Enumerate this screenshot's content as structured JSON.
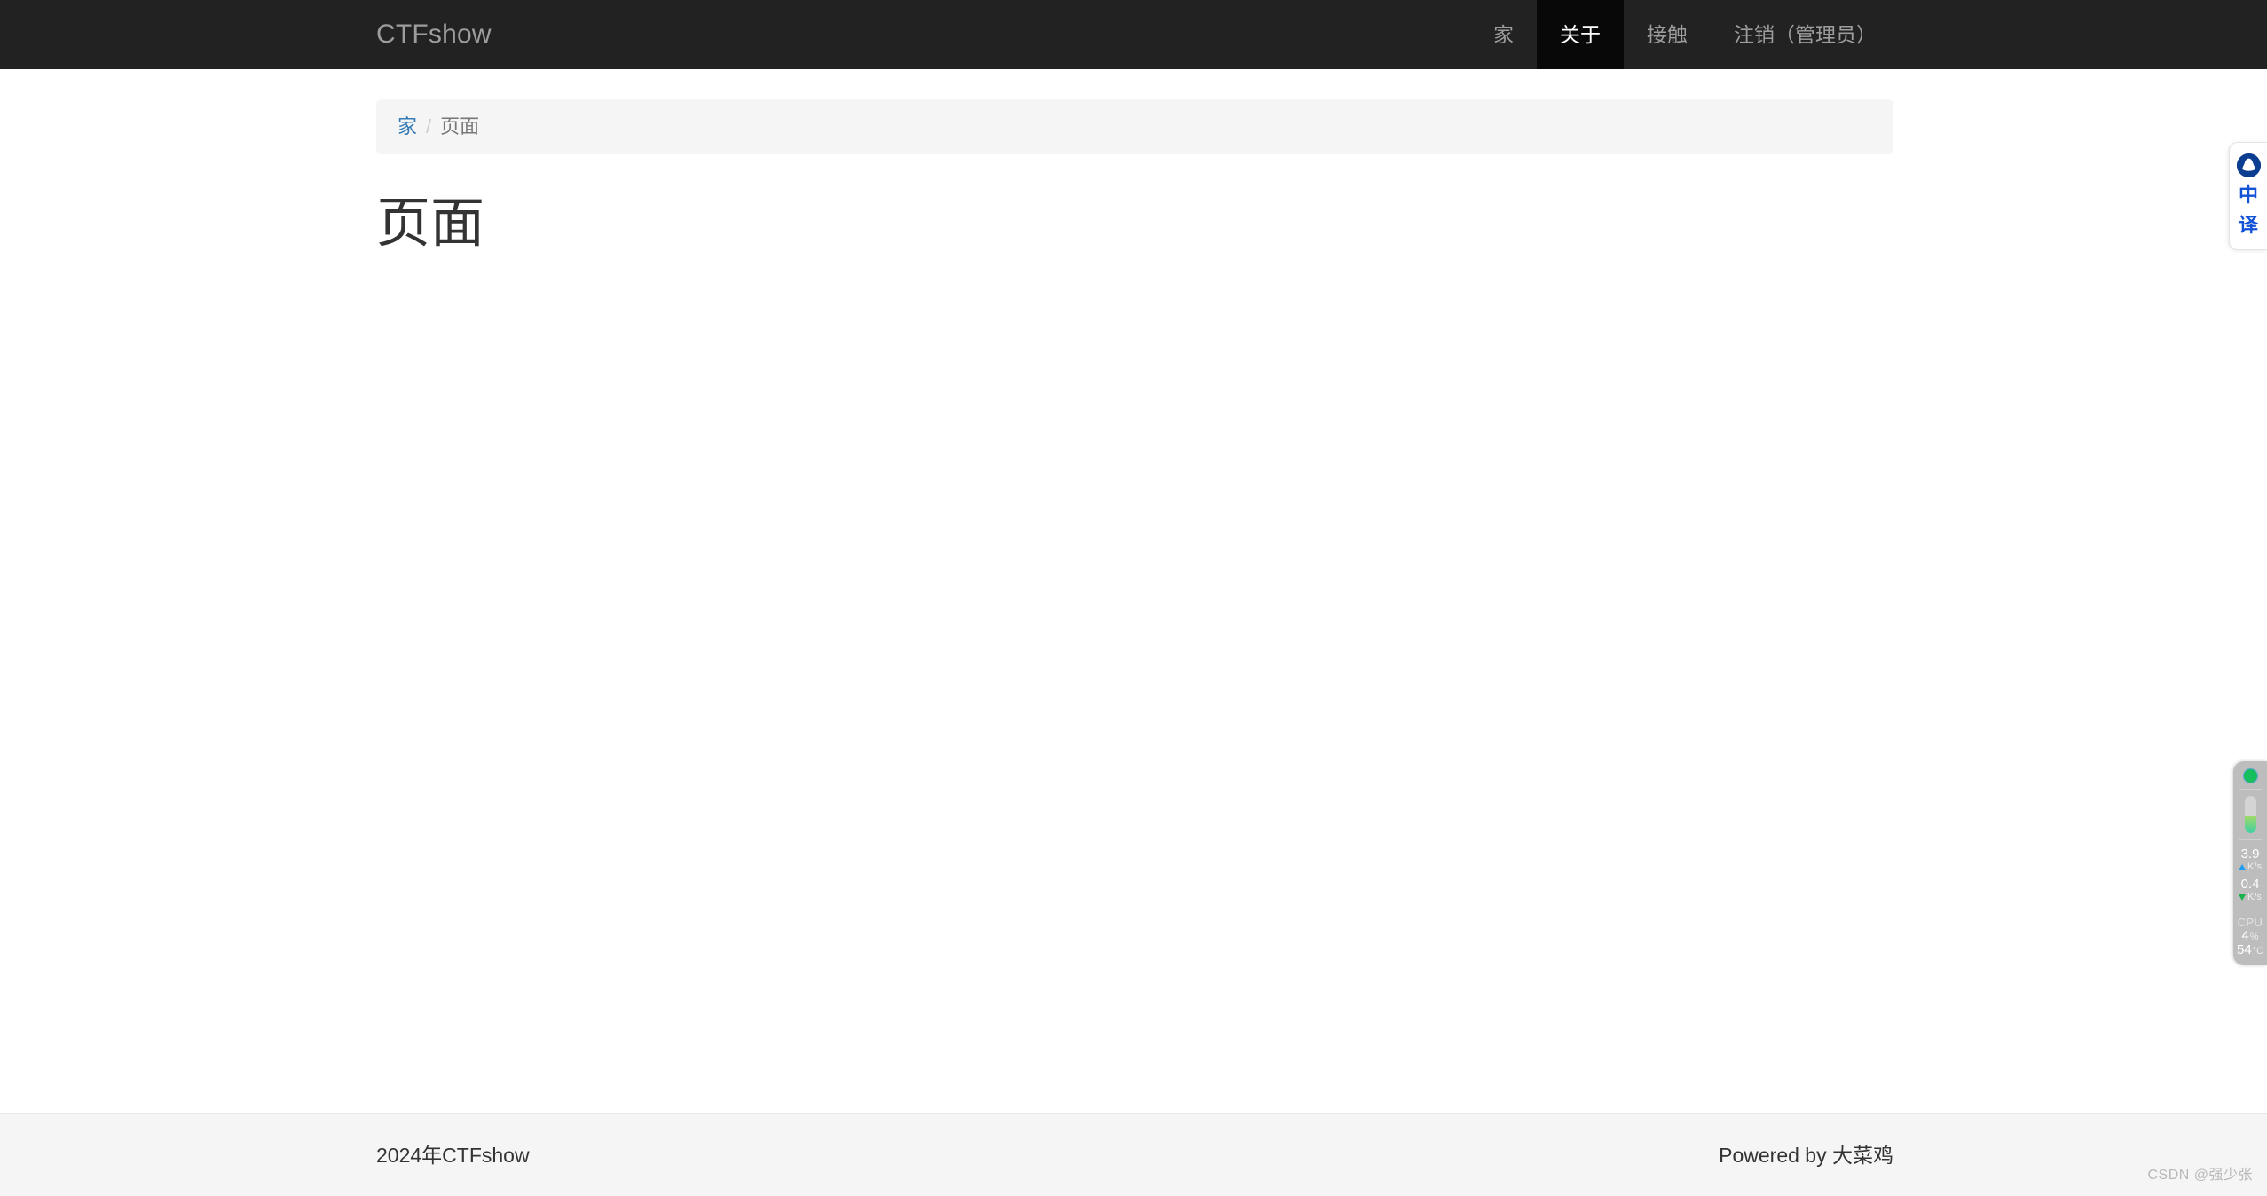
{
  "navbar": {
    "brand": "CTFshow",
    "items": [
      {
        "label": "家",
        "active": false
      },
      {
        "label": "关于",
        "active": true
      },
      {
        "label": "接触",
        "active": false
      },
      {
        "label": "注销（管理员）",
        "active": false
      }
    ],
    "background_color": "#222222",
    "active_background_color": "#080808",
    "text_color": "#9d9d9d"
  },
  "breadcrumb": {
    "home": "家",
    "separator": "/",
    "current": "页面",
    "link_color": "#337ab7"
  },
  "main": {
    "page_title": "页面",
    "body_text": ""
  },
  "footer": {
    "left": "2024年CTFshow",
    "right": "Powered by 大菜鸡"
  },
  "watermark": {
    "text": "CSDN @强少张"
  },
  "translate_widget": {
    "logo_icon": "translate-logo-icon",
    "line1": "中",
    "line2": "译",
    "accent_color": "#1152d6",
    "logo_color": "#0b3d91"
  },
  "system_monitor": {
    "status_indicator": "online",
    "status_color": "#16bf5c",
    "memory_gauge_percent": 45,
    "upload_value": "3.9",
    "upload_unit": "K/s",
    "upload_color": "#1e9cf0",
    "download_value": "0.4",
    "download_unit": "K/s",
    "download_color": "#19b24a",
    "cpu_label": "CPU",
    "cpu_usage": "4",
    "cpu_usage_unit": "%",
    "cpu_temp": "54",
    "cpu_temp_unit": "°C"
  }
}
